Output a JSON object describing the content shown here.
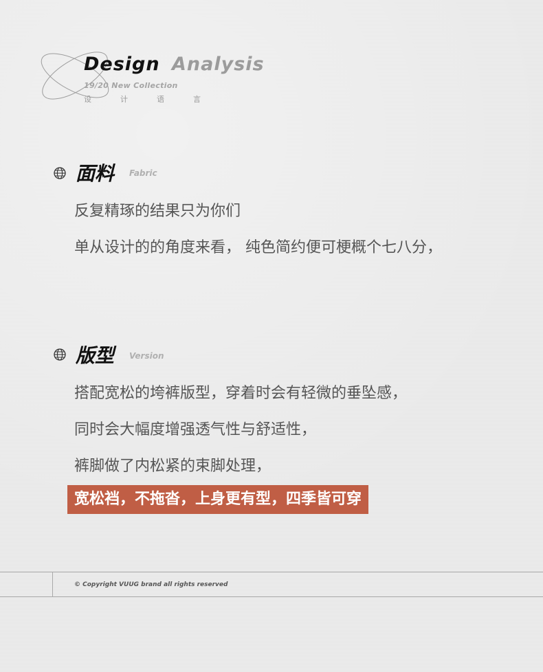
{
  "header": {
    "title_part1": "Design",
    "title_part2": "Analysis",
    "subtitle": "19/20 New Collection",
    "chinese_chars": [
      "设",
      "计",
      "语",
      "言"
    ]
  },
  "sections": [
    {
      "title": "面料",
      "subtitle_en": "Fabric",
      "icon": "globe-icon",
      "lines": [
        "反复精琢的结果只为你们",
        "单从设计的的角度来看， 纯色简约便可梗概个七八分，"
      ]
    },
    {
      "title": "版型",
      "subtitle_en": "Version",
      "icon": "globe-icon",
      "lines": [
        "搭配宽松的垮裤版型，穿着时会有轻微的垂坠感，",
        "同时会大幅度增强透气性与舒适性，",
        "裤脚做了内松紧的束脚处理，"
      ],
      "highlight": "宽松裆，不拖沓，上身更有型，四季皆可穿"
    }
  ],
  "footer": {
    "copyright": "© Copyright VUUG brand all rights reserved"
  },
  "colors": {
    "background": "#ebebeb",
    "title": "#111111",
    "accent_gray": "#9b9b9b",
    "body_text": "#555555",
    "highlight_bg": "#c05e45",
    "highlight_text": "#ffffff"
  }
}
